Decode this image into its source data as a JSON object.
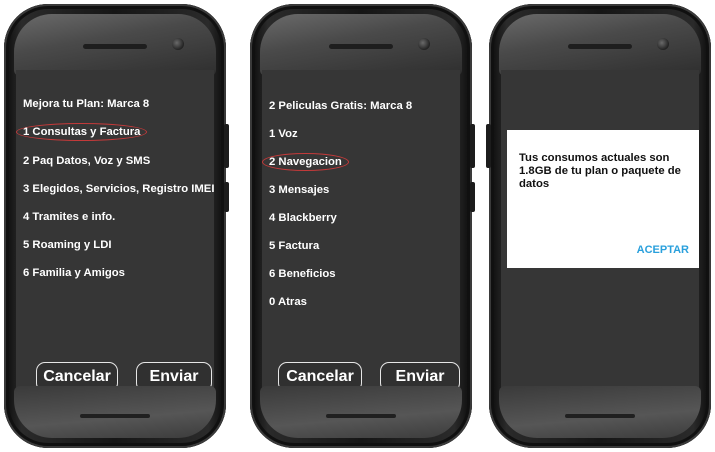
{
  "phone1": {
    "menu_items": [
      "Mejora tu Plan: Marca 8",
      "1 Consultas y Factura",
      "2 Paq Datos, Voz y SMS",
      "3 Elegidos, Servicios, Registro IMEI",
      "4 Tramites e info.",
      "5 Roaming y LDI",
      "6 Familia y Amigos"
    ],
    "highlighted_index": 1,
    "cancel_label": "Cancelar",
    "send_label": "Enviar"
  },
  "phone2": {
    "menu_items": [
      "2 Peliculas Gratis: Marca 8",
      "1 Voz",
      "2 Navegacion",
      "3 Mensajes",
      "4 Blackberry",
      "5 Factura",
      "6 Beneficios",
      "0 Atras"
    ],
    "highlighted_index": 2,
    "cancel_label": "Cancelar",
    "send_label": "Enviar"
  },
  "phone3": {
    "dialog_message": "Tus consumos actuales son 1.8GB de tu plan o paquete de datos",
    "dialog_action": "ACEPTAR"
  },
  "colors": {
    "screen_bg": "#363636",
    "highlight_circle": "#c43a3a",
    "accept_blue": "#2aa0dc"
  }
}
